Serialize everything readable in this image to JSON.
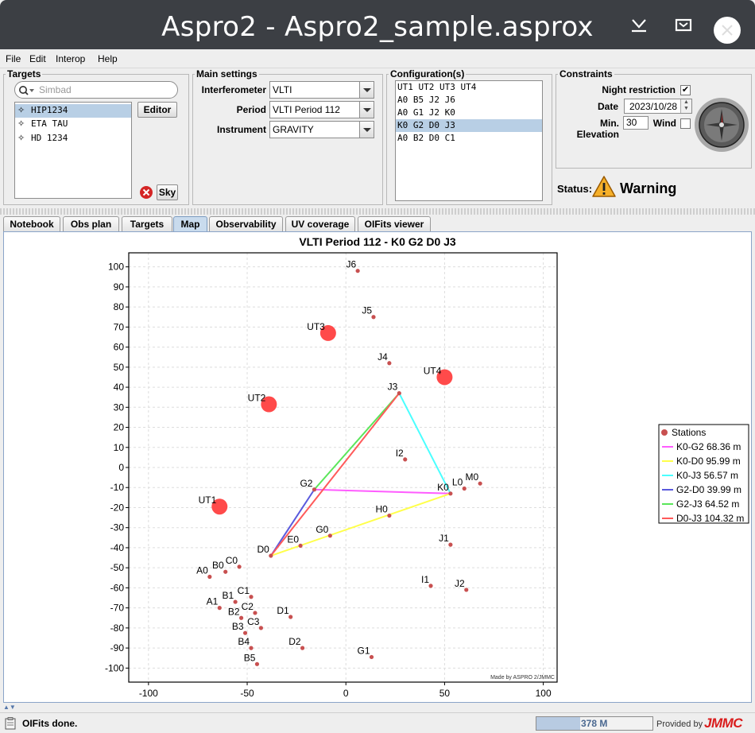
{
  "window": {
    "title": "Aspro2 - Aspro2_sample.asprox"
  },
  "menu": [
    "File",
    "Edit",
    "Interop",
    "Help"
  ],
  "targets": {
    "legend": "Targets",
    "search_placeholder": "Simbad",
    "items": [
      "HIP1234",
      "ETA TAU",
      "HD 1234"
    ],
    "selected_index": 0,
    "editor_label": "Editor",
    "sky_label": "Sky"
  },
  "main_settings": {
    "legend": "Main settings",
    "interferometer_label": "Interferometer",
    "interferometer_value": "VLTI",
    "period_label": "Period",
    "period_value": "VLTI Period 112",
    "instrument_label": "Instrument",
    "instrument_value": "GRAVITY"
  },
  "configurations": {
    "legend": "Configuration(s)",
    "items": [
      "UT1 UT2 UT3 UT4",
      "A0 B5 J2 J6",
      "A0 G1 J2 K0",
      "K0 G2 D0 J3",
      "A0 B2 D0 C1"
    ],
    "selected_index": 3
  },
  "constraints": {
    "legend": "Constraints",
    "night_restriction_label": "Night restriction",
    "night_restriction": true,
    "date_label": "Date",
    "date_value": "2023/10/28",
    "min_elevation_label": "Min. Elevation",
    "min_elevation_value": "30",
    "wind_label": "Wind",
    "wind": false
  },
  "status": {
    "label": "Status:",
    "value": "Warning"
  },
  "tabs": [
    "Notebook",
    "Obs plan",
    "Targets",
    "Map",
    "Observability",
    "UV coverage",
    "OIFits viewer"
  ],
  "selected_tab": "Map",
  "chart_data": {
    "type": "scatter",
    "title": "VLTI Period 112 - K0 G2 D0 J3",
    "xlim": [
      -110,
      107
    ],
    "ylim": [
      -107,
      107
    ],
    "x_ticks": [
      -100,
      -50,
      0,
      50,
      100
    ],
    "y_ticks": [
      100,
      90,
      80,
      70,
      60,
      50,
      40,
      30,
      20,
      10,
      0,
      -10,
      -20,
      -30,
      -40,
      -50,
      -60,
      -70,
      -80,
      -90,
      -100
    ],
    "grid": true,
    "watermark": "Made by ASPRO 2/JMMC",
    "colors": {
      "station": "#c85050",
      "telescope": "#ff4a4a"
    },
    "telescopes": [
      {
        "name": "UT1",
        "x": -64,
        "y": -19.5
      },
      {
        "name": "UT2",
        "x": -39,
        "y": 31.5
      },
      {
        "name": "UT3",
        "x": -9,
        "y": 67
      },
      {
        "name": "UT4",
        "x": 50,
        "y": 45
      }
    ],
    "stations": [
      {
        "name": "J6",
        "x": 6,
        "y": 98
      },
      {
        "name": "J5",
        "x": 14,
        "y": 75
      },
      {
        "name": "J4",
        "x": 22,
        "y": 52
      },
      {
        "name": "J3",
        "x": 27,
        "y": 37
      },
      {
        "name": "I2",
        "x": 30,
        "y": 4
      },
      {
        "name": "G2",
        "x": -16,
        "y": -11
      },
      {
        "name": "K0",
        "x": 53,
        "y": -13
      },
      {
        "name": "L0",
        "x": 60,
        "y": -10.5
      },
      {
        "name": "M0",
        "x": 68,
        "y": -8
      },
      {
        "name": "H0",
        "x": 22,
        "y": -24
      },
      {
        "name": "G0",
        "x": -8,
        "y": -34
      },
      {
        "name": "E0",
        "x": -23,
        "y": -39
      },
      {
        "name": "D0",
        "x": -38,
        "y": -44
      },
      {
        "name": "J1",
        "x": 53,
        "y": -38.5
      },
      {
        "name": "C0",
        "x": -54,
        "y": -49.5
      },
      {
        "name": "B0",
        "x": -61,
        "y": -52
      },
      {
        "name": "A0",
        "x": -69,
        "y": -54.5
      },
      {
        "name": "I1",
        "x": 43,
        "y": -59
      },
      {
        "name": "J2",
        "x": 61,
        "y": -61
      },
      {
        "name": "C1",
        "x": -48,
        "y": -64.5
      },
      {
        "name": "B1",
        "x": -56,
        "y": -67
      },
      {
        "name": "A1",
        "x": -64,
        "y": -70
      },
      {
        "name": "C2",
        "x": -46,
        "y": -72.5
      },
      {
        "name": "B2",
        "x": -53,
        "y": -75
      },
      {
        "name": "D1",
        "x": -28,
        "y": -74.5
      },
      {
        "name": "C3",
        "x": -43,
        "y": -80
      },
      {
        "name": "B3",
        "x": -51,
        "y": -82.5
      },
      {
        "name": "B4",
        "x": -48,
        "y": -90
      },
      {
        "name": "D2",
        "x": -22,
        "y": -90
      },
      {
        "name": "G1",
        "x": 13,
        "y": -94.5
      },
      {
        "name": "B5",
        "x": -45,
        "y": -98
      }
    ],
    "baselines": [
      {
        "label": "K0-G2 68.36 m",
        "from": "K0",
        "to": "G2",
        "color": "#ff5cff"
      },
      {
        "label": "K0-D0 95.99 m",
        "from": "K0",
        "to": "D0",
        "color": "#ffff4a"
      },
      {
        "label": "K0-J3 56.57 m",
        "from": "K0",
        "to": "J3",
        "color": "#4affff"
      },
      {
        "label": "G2-D0 39.99 m",
        "from": "G2",
        "to": "D0",
        "color": "#5a5add"
      },
      {
        "label": "G2-J3 64.52 m",
        "from": "G2",
        "to": "J3",
        "color": "#5ae65a"
      },
      {
        "label": "D0-J3 104.32 m",
        "from": "D0",
        "to": "J3",
        "color": "#ff5a5a"
      }
    ],
    "legend_title": "Stations",
    "legend_position": "right"
  },
  "statusbar": {
    "message": "OIFits done.",
    "memory": "378 M",
    "memory_fraction": 0.38,
    "provided_by": "Provided by",
    "brand": "JMMC"
  }
}
